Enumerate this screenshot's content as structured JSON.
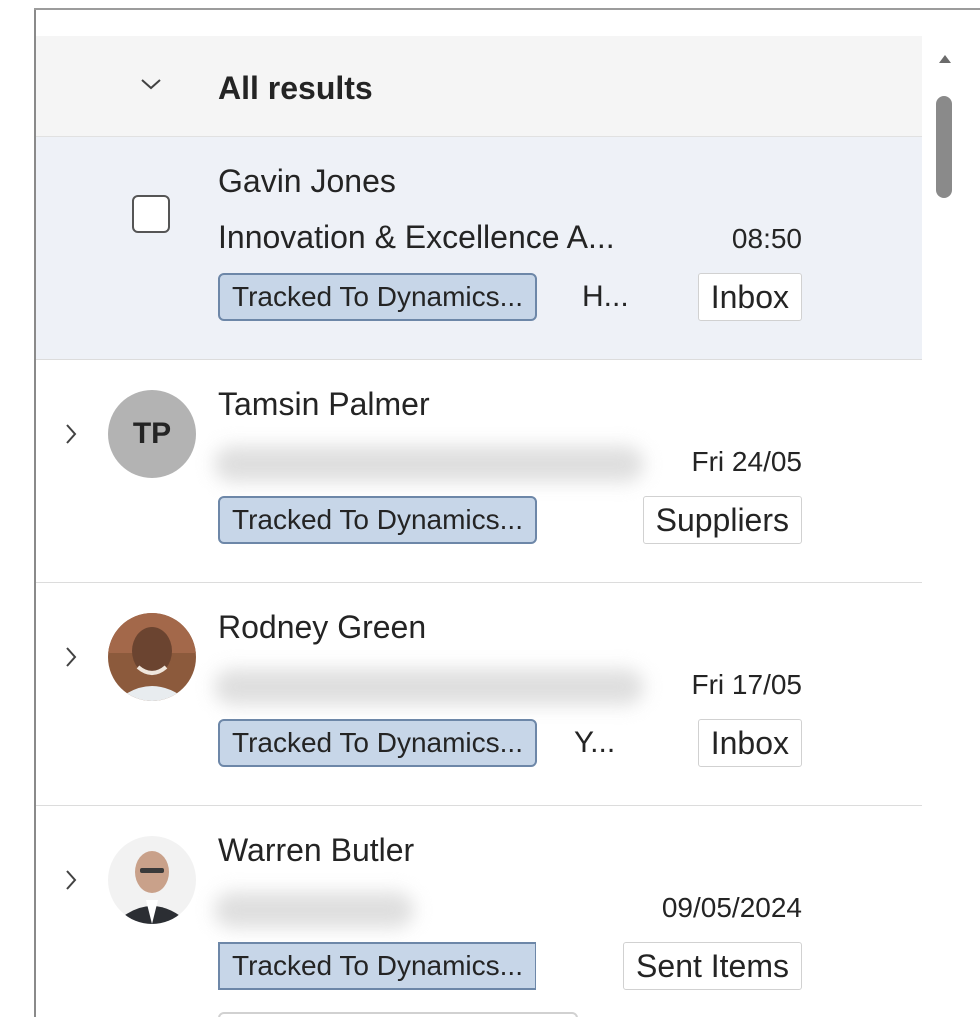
{
  "header": {
    "title": "All results"
  },
  "messages": [
    {
      "sender": "Gavin Jones",
      "subject": "Innovation & Excellence A...",
      "time": "08:50",
      "tag": "Tracked To Dynamics...",
      "preview": "H...",
      "folder": "Inbox",
      "selected": true
    },
    {
      "sender": "Tamsin Palmer",
      "initials": "TP",
      "subject": "",
      "time": "Fri 24/05",
      "tag": "Tracked To Dynamics...",
      "preview": "",
      "folder": "Suppliers"
    },
    {
      "sender": "Rodney Green",
      "subject": "",
      "time": "Fri 17/05",
      "tag": "Tracked To Dynamics...",
      "preview": "Y...",
      "folder": "Inbox"
    },
    {
      "sender": "Warren Butler",
      "subject": "",
      "time": "09/05/2024",
      "tag": "Tracked To Dynamics...",
      "preview": "",
      "folder": "Sent Items"
    }
  ],
  "colors": {
    "selected_row": "#eef1f7",
    "category_tag": "#c7d6e8",
    "category_border": "#6d87a8",
    "header_bg": "#f5f5f5"
  },
  "icons": [
    "chevron-down-icon",
    "chevron-right-icon",
    "scroll-up-arrow-icon"
  ]
}
